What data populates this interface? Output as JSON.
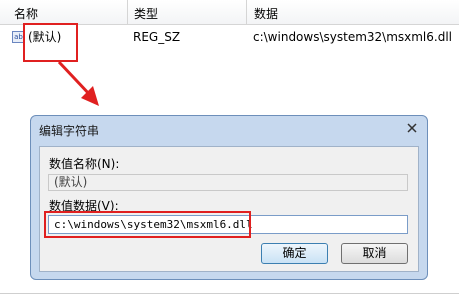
{
  "list_header": {
    "columns": [
      "名称",
      "类型",
      "数据"
    ]
  },
  "registry_row": {
    "icon": "reg-string-icon",
    "icon_text": "ab",
    "name": "(默认)",
    "type": "REG_SZ",
    "data": "c:\\windows\\system32\\msxml6.dll"
  },
  "dialog": {
    "title": "编辑字符串",
    "value_name_label": "数值名称(N):",
    "value_name": "(默认)",
    "value_data_label": "数值数据(V):",
    "value_data": "c:\\windows\\system32\\msxml6.dll",
    "ok_label": "确定",
    "cancel_label": "取消"
  },
  "colors": {
    "highlight": "#e02020",
    "dialog_frame": "#c6d8ee"
  }
}
